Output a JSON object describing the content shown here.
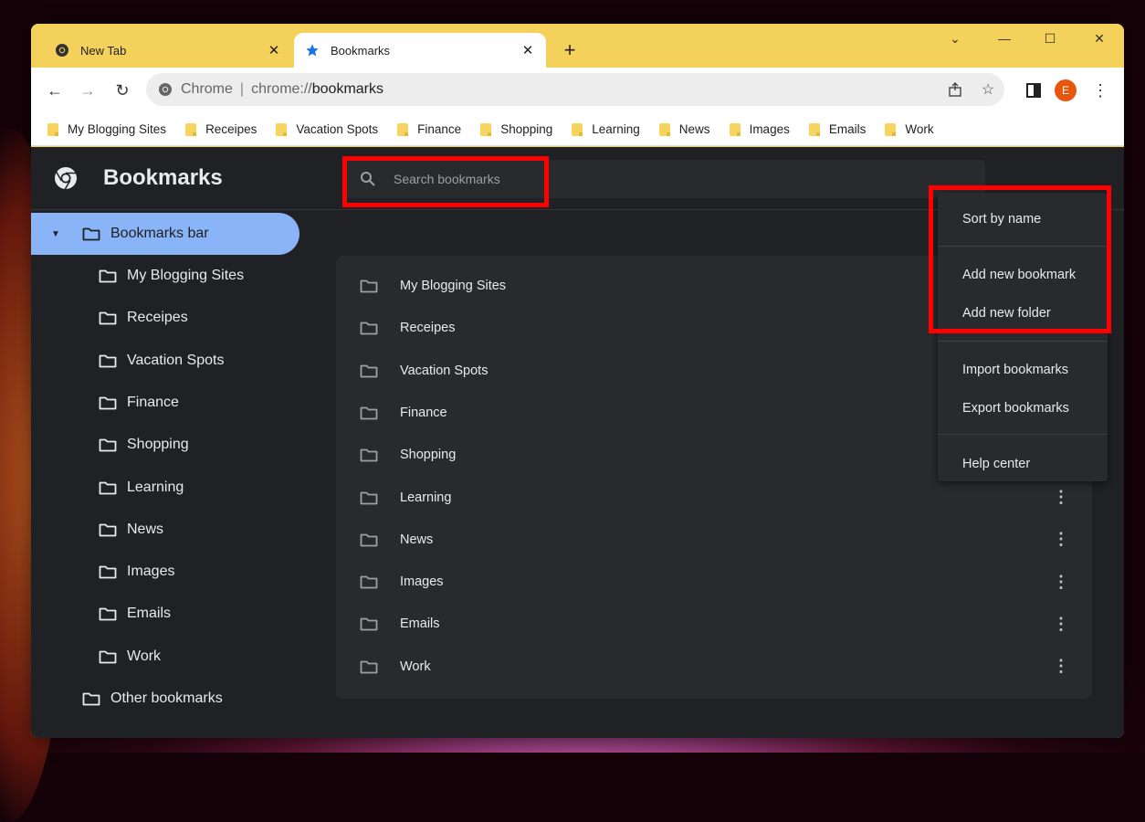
{
  "browser": {
    "tabs": [
      {
        "label": "New Tab",
        "icon": "chrome-icon",
        "active": false
      },
      {
        "label": "Bookmarks",
        "icon": "star-icon",
        "active": true
      }
    ],
    "new_tab_symbol": "+",
    "window_controls": {
      "dropdown": "⌄",
      "minimize": "—",
      "maximize": "☐",
      "close": "✕"
    },
    "omnibox": {
      "origin": "Chrome",
      "separator": "|",
      "url_prefix": "chrome://",
      "url_host": "bookmarks"
    },
    "profile_initial": "E",
    "bookmarks_bar": [
      "My Blogging Sites",
      "Receipes",
      "Vacation Spots",
      "Finance",
      "Shopping",
      "Learning",
      "News",
      "Images",
      "Emails",
      "Work"
    ]
  },
  "app": {
    "title": "Bookmarks",
    "search_placeholder": "Search bookmarks"
  },
  "sidebar": {
    "root": "Bookmarks bar",
    "children": [
      "My Blogging Sites",
      "Receipes",
      "Vacation Spots",
      "Finance",
      "Shopping",
      "Learning",
      "News",
      "Images",
      "Emails",
      "Work"
    ],
    "other": "Other bookmarks"
  },
  "list": {
    "items": [
      "My Blogging Sites",
      "Receipes",
      "Vacation Spots",
      "Finance",
      "Shopping",
      "Learning",
      "News",
      "Images",
      "Emails",
      "Work"
    ],
    "more_symbol": "⋮"
  },
  "menu": {
    "items": [
      "Sort by name",
      "Add new bookmark",
      "Add new folder",
      "Import bookmarks",
      "Export bookmarks",
      "Help center"
    ]
  },
  "colors": {
    "accent": "#8ab4f8",
    "highlight": "#ff0000",
    "page_bg": "#202124",
    "surface": "#292a2d",
    "tabstrip": "#f4d15a"
  }
}
